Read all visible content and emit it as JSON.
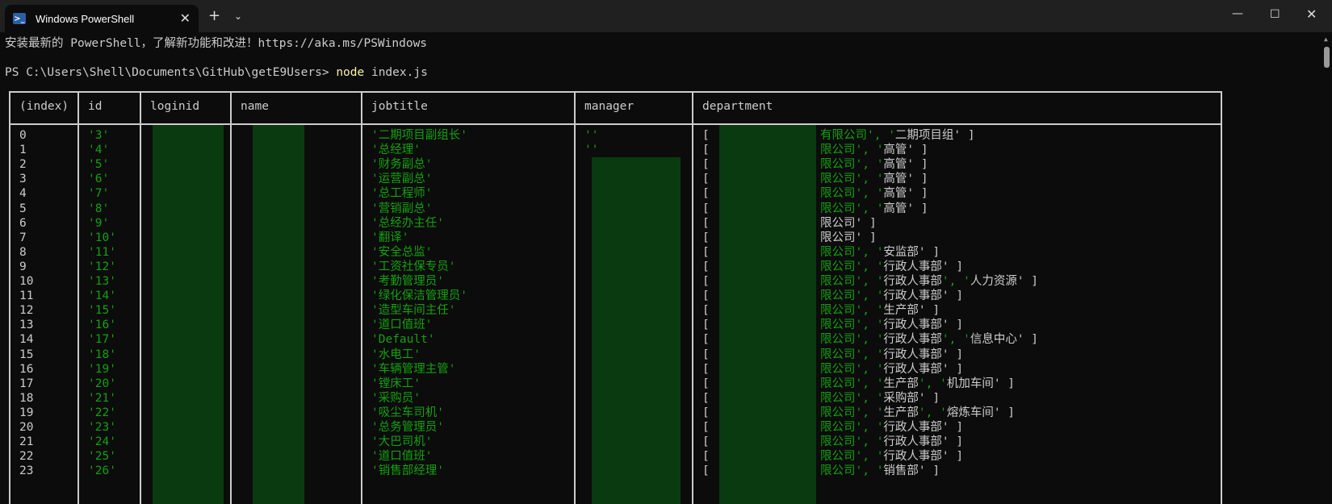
{
  "window": {
    "tab_title": "Windows PowerShell",
    "tab_close": "✕",
    "new_tab": "+",
    "dropdown": "⌄",
    "minimize": "—",
    "maximize": "☐",
    "close": "✕"
  },
  "terminal": {
    "banner": "安装最新的 PowerShell，了解新功能和改进！https://aka.ms/PSWindows",
    "prompt": "PS C:\\Users\\Shell\\Documents\\GitHub\\getE9Users> ",
    "command": "node",
    "command_arg": " index.js"
  },
  "table": {
    "headers": [
      "(index)",
      "id",
      "loginid",
      "name",
      "jobtitle",
      "manager",
      "department"
    ],
    "rows": [
      {
        "index": "0",
        "id": "'3'",
        "manager": "''",
        "jobtitle": "'二期项目副组长'",
        "dept": "有限公司', '二期项目组' ]"
      },
      {
        "index": "1",
        "id": "'4'",
        "manager": "''",
        "jobtitle": "'总经理'",
        "dept": "限公司', '高管' ]"
      },
      {
        "index": "2",
        "id": "'5'",
        "manager": "",
        "jobtitle": "'财务副总'",
        "dept": "限公司', '高管' ]"
      },
      {
        "index": "3",
        "id": "'6'",
        "manager": "",
        "jobtitle": "'运营副总'",
        "dept": "限公司', '高管' ]"
      },
      {
        "index": "4",
        "id": "'7'",
        "manager": "",
        "jobtitle": "'总工程师'",
        "dept": "限公司', '高管' ]"
      },
      {
        "index": "5",
        "id": "'8'",
        "manager": "",
        "jobtitle": "'营销副总'",
        "dept": "限公司', '高管' ]"
      },
      {
        "index": "6",
        "id": "'9'",
        "manager": "",
        "jobtitle": "'总经办主任'",
        "dept": "限公司' ]"
      },
      {
        "index": "7",
        "id": "'10'",
        "manager": "",
        "jobtitle": "'翻译'",
        "dept": "限公司' ]"
      },
      {
        "index": "8",
        "id": "'11'",
        "manager": "",
        "jobtitle": "'安全总监'",
        "dept": "限公司', '安监部' ]"
      },
      {
        "index": "9",
        "id": "'12'",
        "manager": "",
        "jobtitle": "'工资社保专员'",
        "dept": "限公司', '行政人事部' ]"
      },
      {
        "index": "10",
        "id": "'13'",
        "manager": "",
        "jobtitle": "'考勤管理员'",
        "dept": "限公司', '行政人事部', '人力资源' ]"
      },
      {
        "index": "11",
        "id": "'14'",
        "manager": "",
        "jobtitle": "'绿化保洁管理员'",
        "dept": "限公司', '行政人事部' ]"
      },
      {
        "index": "12",
        "id": "'15'",
        "manager": "",
        "jobtitle": "'造型车间主任'",
        "dept": "限公司', '生产部' ]"
      },
      {
        "index": "13",
        "id": "'16'",
        "manager": "",
        "jobtitle": "'道口值班'",
        "dept": "限公司', '行政人事部' ]"
      },
      {
        "index": "14",
        "id": "'17'",
        "manager": "",
        "jobtitle": "'Default'",
        "dept": "限公司', '行政人事部', '信息中心' ]"
      },
      {
        "index": "15",
        "id": "'18'",
        "manager": "",
        "jobtitle": "'水电工'",
        "dept": "限公司', '行政人事部' ]"
      },
      {
        "index": "16",
        "id": "'19'",
        "manager": "",
        "jobtitle": "'车辆管理主管'",
        "dept": "限公司', '行政人事部' ]"
      },
      {
        "index": "17",
        "id": "'20'",
        "manager": "",
        "jobtitle": "'镗床工'",
        "dept": "限公司', '生产部', '机加车间' ]"
      },
      {
        "index": "18",
        "id": "'21'",
        "manager": "",
        "jobtitle": "'采购员'",
        "dept": "限公司', '采购部' ]"
      },
      {
        "index": "19",
        "id": "'22'",
        "manager": "",
        "jobtitle": "'吸尘车司机'",
        "dept": "限公司', '生产部', '熔炼车间' ]"
      },
      {
        "index": "20",
        "id": "'23'",
        "manager": "",
        "jobtitle": "'总务管理员'",
        "dept": "限公司', '行政人事部' ]"
      },
      {
        "index": "21",
        "id": "'24'",
        "manager": "",
        "jobtitle": "'大巴司机'",
        "dept": "限公司', '行政人事部' ]"
      },
      {
        "index": "22",
        "id": "'25'",
        "manager": "",
        "jobtitle": "'道口值班'",
        "dept": "限公司', '行政人事部' ]"
      },
      {
        "index": "23",
        "id": "'26'",
        "manager": "",
        "jobtitle": "'销售部经理'",
        "dept": "限公司', '销售部' ]"
      }
    ],
    "dept_open": "["
  },
  "colors": {
    "background": "#0c0c0c",
    "titlebar": "#202020",
    "string_green": "#13a10e",
    "command_yellow": "#f9f1a5",
    "text": "#cccccc"
  }
}
